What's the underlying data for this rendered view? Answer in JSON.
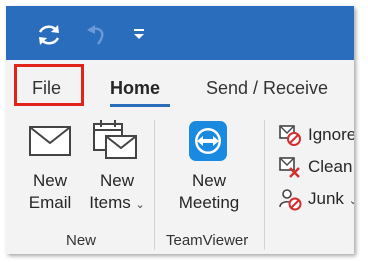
{
  "quick_access": {
    "icons": [
      "refresh-icon",
      "undo-icon",
      "customize-dropdown-icon"
    ]
  },
  "tabs": {
    "file": "File",
    "home": "Home",
    "send_receive": "Send / Receive"
  },
  "ribbon": {
    "new_group": {
      "label": "New",
      "new_email": {
        "line1": "New",
        "line2": "Email",
        "icon": "envelope-icon"
      },
      "new_items": {
        "line1": "New",
        "line2": "Items",
        "icon": "calendar-envelope-icon",
        "dropdown": "⌄"
      }
    },
    "teamviewer_group": {
      "label": "TeamViewer",
      "new_meeting": {
        "line1": "New",
        "line2": "Meeting",
        "icon": "teamviewer-icon"
      }
    },
    "delete_group": {
      "ignore": {
        "label": "Ignore",
        "icon": "ignore-icon"
      },
      "clean_up": {
        "label": "Clean Up",
        "icon": "clean-up-icon"
      },
      "junk": {
        "label": "Junk",
        "icon": "junk-icon",
        "dropdown": "⌄"
      }
    }
  },
  "colors": {
    "accent": "#2b6dbd",
    "highlight": "#e2231a",
    "ribbon_bg": "#f3f3f3"
  }
}
